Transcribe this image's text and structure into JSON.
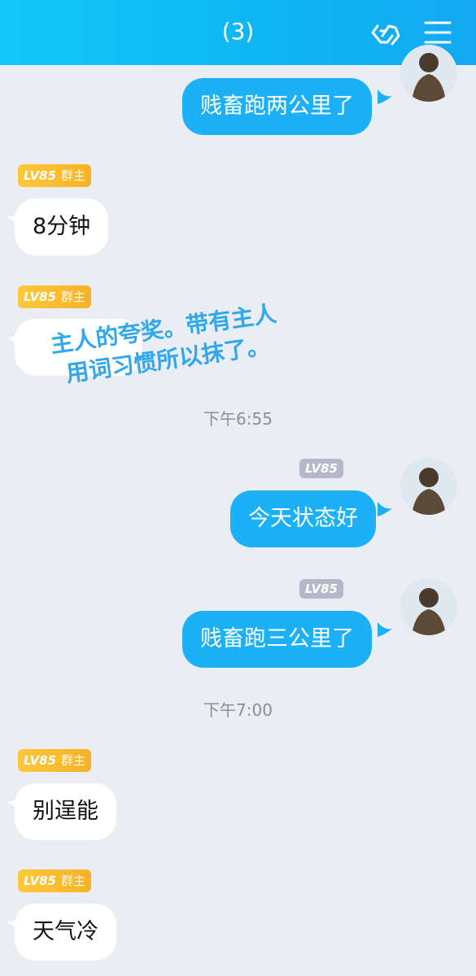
{
  "header": {
    "title": "(3)"
  },
  "badges": {
    "level": "LV85",
    "owner_role": "群主"
  },
  "messages": {
    "m1": "贱畜跑两公里了",
    "m2": "8分钟",
    "m4": "今天状态好",
    "m5": "贱畜跑三公里了",
    "m6": "别逞能",
    "m7": "天气冷"
  },
  "timestamps": {
    "t1": "下午6:55",
    "t2": "下午7:00"
  },
  "overlay": {
    "line1": "主人的夸奖。带有主人",
    "line2": "用词习惯所以抹了。"
  },
  "colors": {
    "header": "#13b8f6",
    "bubble_right": "#1cb1f6",
    "badge_gold": "#f8b224",
    "overlay_text": "#2fa8ee"
  }
}
